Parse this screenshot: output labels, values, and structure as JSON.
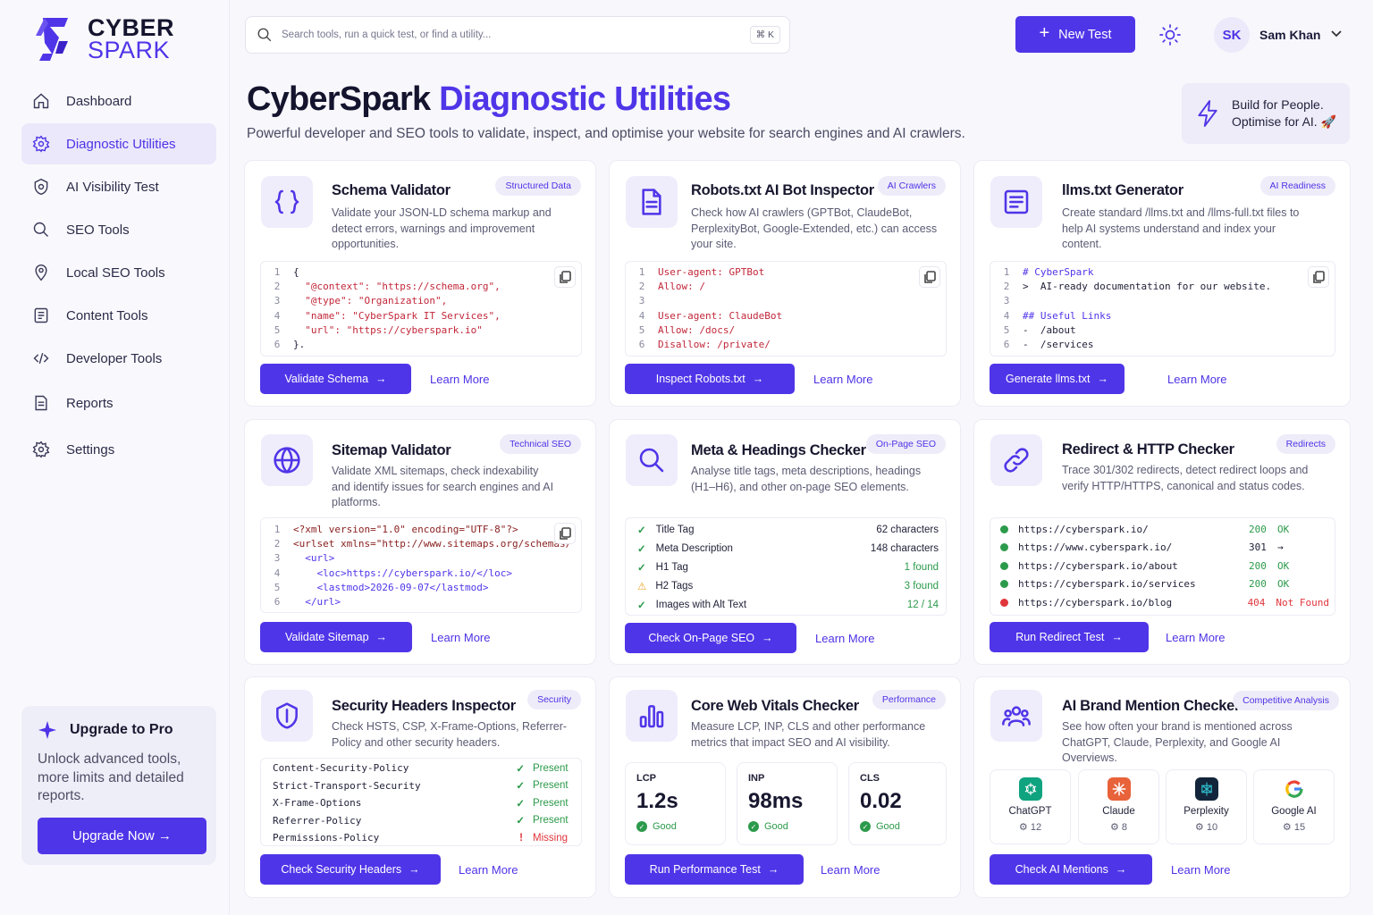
{
  "brand": {
    "line1": "CYBER",
    "line2": "SPARK"
  },
  "sidebar": {
    "items": [
      {
        "label": "Dashboard",
        "icon": "home-icon",
        "active": false
      },
      {
        "label": "Diagnostic Utilities",
        "icon": "gear-icon",
        "active": true
      },
      {
        "label": "AI Visibility Test",
        "icon": "shield-gear-icon",
        "active": false
      },
      {
        "label": "SEO Tools",
        "icon": "search-icon",
        "active": false
      },
      {
        "label": "Local SEO Tools",
        "icon": "map-pin-icon",
        "active": false
      },
      {
        "label": "Content Tools",
        "icon": "document-icon",
        "active": false
      },
      {
        "label": "Developer Tools",
        "icon": "code-icon",
        "active": false
      },
      {
        "label": "Reports",
        "icon": "report-icon",
        "active": false
      },
      {
        "label": "Settings",
        "icon": "settings-icon",
        "active": false
      }
    ],
    "promo": {
      "title": "Upgrade to Pro",
      "text": "Unlock advanced tools, more limits and detailed reports.",
      "button": "Upgrade Now →"
    }
  },
  "header": {
    "search_placeholder": "Search tools, run a quick test, or find a utility...",
    "shortcut": "⌘ K",
    "new_test": "New Test",
    "user_initials": "SK",
    "user_name": "Sam Khan"
  },
  "page": {
    "title_main": "CyberSpark",
    "title_accent": "Diagnostic Utilities",
    "subtitle": "Powerful developer and SEO tools to validate, inspect, and optimise your website for search engines and AI crawlers.",
    "tagline_1": "Build for People.",
    "tagline_2": "Optimise for AI."
  },
  "cards": {
    "schema": {
      "title": "Schema Validator",
      "badge": "Structured Data",
      "desc": "Validate your JSON-LD schema markup and detect errors, warnings and improvement opportunities.",
      "code": [
        "{",
        "  \"@context\": \"https://schema.org\",",
        "  \"@type\": \"Organization\",",
        "  \"name\": \"CyberSpark IT Services\",",
        "  \"url\": \"https://cyberspark.io\"",
        "}."
      ],
      "button": "Validate Schema",
      "learn": "Learn More"
    },
    "robots": {
      "title": "Robots.txt AI Bot Inspector",
      "badge": "AI Crawlers",
      "desc": "Check how AI crawlers (GPTBot, ClaudeBot, PerplexityBot, Google-Extended, etc.) can access your site.",
      "code": [
        "User-agent: GPTBot",
        "Allow: /",
        "",
        "User-agent: ClaudeBot",
        "Allow: /docs/",
        "Disallow: /private/"
      ],
      "button": "Inspect Robots.txt",
      "learn": "Learn More"
    },
    "llms": {
      "title": "llms.txt Generator",
      "badge": "AI Readiness",
      "desc": "Create standard /llms.txt and /llms-full.txt files to help AI systems understand and index your content.",
      "code": [
        "# CyberSpark",
        ">  AI-ready documentation for our website.",
        "",
        "## Useful Links",
        "-  /about",
        "-  /services"
      ],
      "button": "Generate llms.txt",
      "learn": "Learn More"
    },
    "sitemap": {
      "title": "Sitemap Validator",
      "badge": "Technical SEO",
      "desc": "Validate XML sitemaps, check indexability and identify issues for search engines and AI platforms.",
      "code": [
        "<?xml version=\"1.0\" encoding=\"UTF-8\"?>",
        "<urlset xmlns=\"http://www.sitemaps.org/schemas/",
        "  <url>",
        "    <loc>https://cyberspark.io/</loc>",
        "    <lastmod>2026-09-07</lastmod>",
        "  </url>"
      ],
      "button": "Validate Sitemap",
      "learn": "Learn More"
    },
    "meta": {
      "title": "Meta & Headings Checker",
      "badge": "On-Page SEO",
      "desc": "Analyse title tags, meta descriptions, headings (H1–H6), and other on-page SEO elements.",
      "rows": [
        {
          "label": "Title Tag",
          "value": "62 characters",
          "status": "ok"
        },
        {
          "label": "Meta Description",
          "value": "148 characters",
          "status": "ok"
        },
        {
          "label": "H1 Tag",
          "value": "1 found",
          "status": "ok"
        },
        {
          "label": "H2 Tags",
          "value": "3 found",
          "status": "warn"
        },
        {
          "label": "Images with Alt Text",
          "value": "12 / 14",
          "status": "ok"
        }
      ],
      "button": "Check On-Page SEO",
      "learn": "Learn More"
    },
    "redirect": {
      "title": "Redirect & HTTP Checker",
      "badge": "Redirects",
      "desc": "Trace 301/302 redirects, detect redirect loops and verify HTTP/HTTPS, canonical and status codes.",
      "rows": [
        {
          "url": "https://cyberspark.io/",
          "code": "200",
          "text": "OK",
          "color": "#2c9a4b"
        },
        {
          "url": "https://www.cyberspark.io/",
          "code": "301",
          "text": "→",
          "color": "#2c9a4b"
        },
        {
          "url": "https://cyberspark.io/about",
          "code": "200",
          "text": "OK",
          "color": "#2c9a4b"
        },
        {
          "url": "https://cyberspark.io/services",
          "code": "200",
          "text": "OK",
          "color": "#2c9a4b"
        },
        {
          "url": "https://cyberspark.io/blog",
          "code": "404",
          "text": "Not Found",
          "color": "#e0353b"
        }
      ],
      "button": "Run Redirect Test",
      "learn": "Learn More"
    },
    "security": {
      "title": "Security Headers Inspector",
      "badge": "Security",
      "desc": "Check HSTS, CSP, X-Frame-Options, Referrer-Policy and other security headers.",
      "rows": [
        {
          "header": "Content-Security-Policy",
          "status": "Present",
          "ok": true
        },
        {
          "header": "Strict-Transport-Security",
          "status": "Present",
          "ok": true
        },
        {
          "header": "X-Frame-Options",
          "status": "Present",
          "ok": true
        },
        {
          "header": "Referrer-Policy",
          "status": "Present",
          "ok": true
        },
        {
          "header": "Permissions-Policy",
          "status": "Missing",
          "ok": false
        }
      ],
      "button": "Check Security Headers",
      "learn": "Learn More"
    },
    "cwv": {
      "title": "Core Web Vitals Checker",
      "badge": "Performance",
      "desc": "Measure LCP, INP, CLS and other performance metrics that impact SEO and AI visibility.",
      "metrics": [
        {
          "label": "LCP",
          "value": "1.2s",
          "status": "Good"
        },
        {
          "label": "INP",
          "value": "98ms",
          "status": "Good"
        },
        {
          "label": "CLS",
          "value": "0.02",
          "status": "Good"
        }
      ],
      "button": "Run Performance Test",
      "learn": "Learn More"
    },
    "brandmention": {
      "title": "AI Brand Mention Checker",
      "badge": "Competitive Analysis",
      "desc": "See how often your brand is mentioned across ChatGPT, Claude, Perplexity, and Google AI Overviews.",
      "brands": [
        {
          "name": "ChatGPT",
          "count": "12"
        },
        {
          "name": "Claude",
          "count": "8"
        },
        {
          "name": "Perplexity",
          "count": "10"
        },
        {
          "name": "Google AI",
          "count": "15"
        }
      ],
      "button": "Check AI Mentions",
      "learn": "Learn More"
    }
  },
  "colors": {
    "accent": "#4f35e8",
    "success": "#2c9a4b",
    "error": "#e0353b",
    "warning": "#f0a020"
  }
}
